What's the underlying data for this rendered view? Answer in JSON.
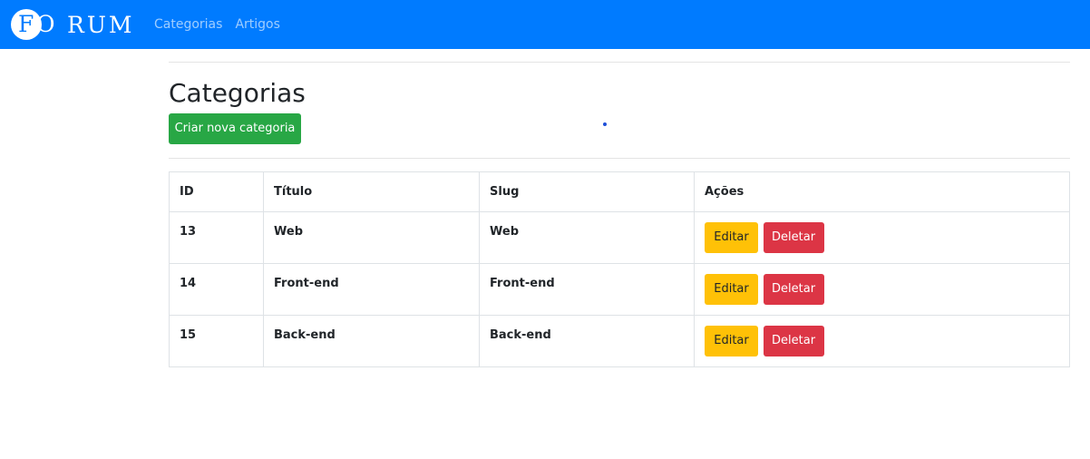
{
  "navbar": {
    "brand": {
      "logo_letter_1": "F",
      "logo_letter_2": "O",
      "rest": "RUM",
      "color": "#007bff"
    },
    "links": [
      {
        "label": "Categorias"
      },
      {
        "label": "Artigos"
      }
    ]
  },
  "main": {
    "title": "Categorias",
    "create_button": "Criar nova categoria",
    "table": {
      "headers": {
        "id": "ID",
        "title": "Título",
        "slug": "Slug",
        "actions": "Ações"
      },
      "rows": [
        {
          "id": "13",
          "title": "Web",
          "slug": "Web",
          "edit": "Editar",
          "delete": "Deletar"
        },
        {
          "id": "14",
          "title": "Front-end",
          "slug": "Front-end",
          "edit": "Editar",
          "delete": "Deletar"
        },
        {
          "id": "15",
          "title": "Back-end",
          "slug": "Back-end",
          "edit": "Editar",
          "delete": "Deletar"
        }
      ]
    }
  },
  "colors": {
    "navbar": "#007bff",
    "success": "#28a745",
    "warning": "#ffc107",
    "danger": "#dc3545"
  }
}
